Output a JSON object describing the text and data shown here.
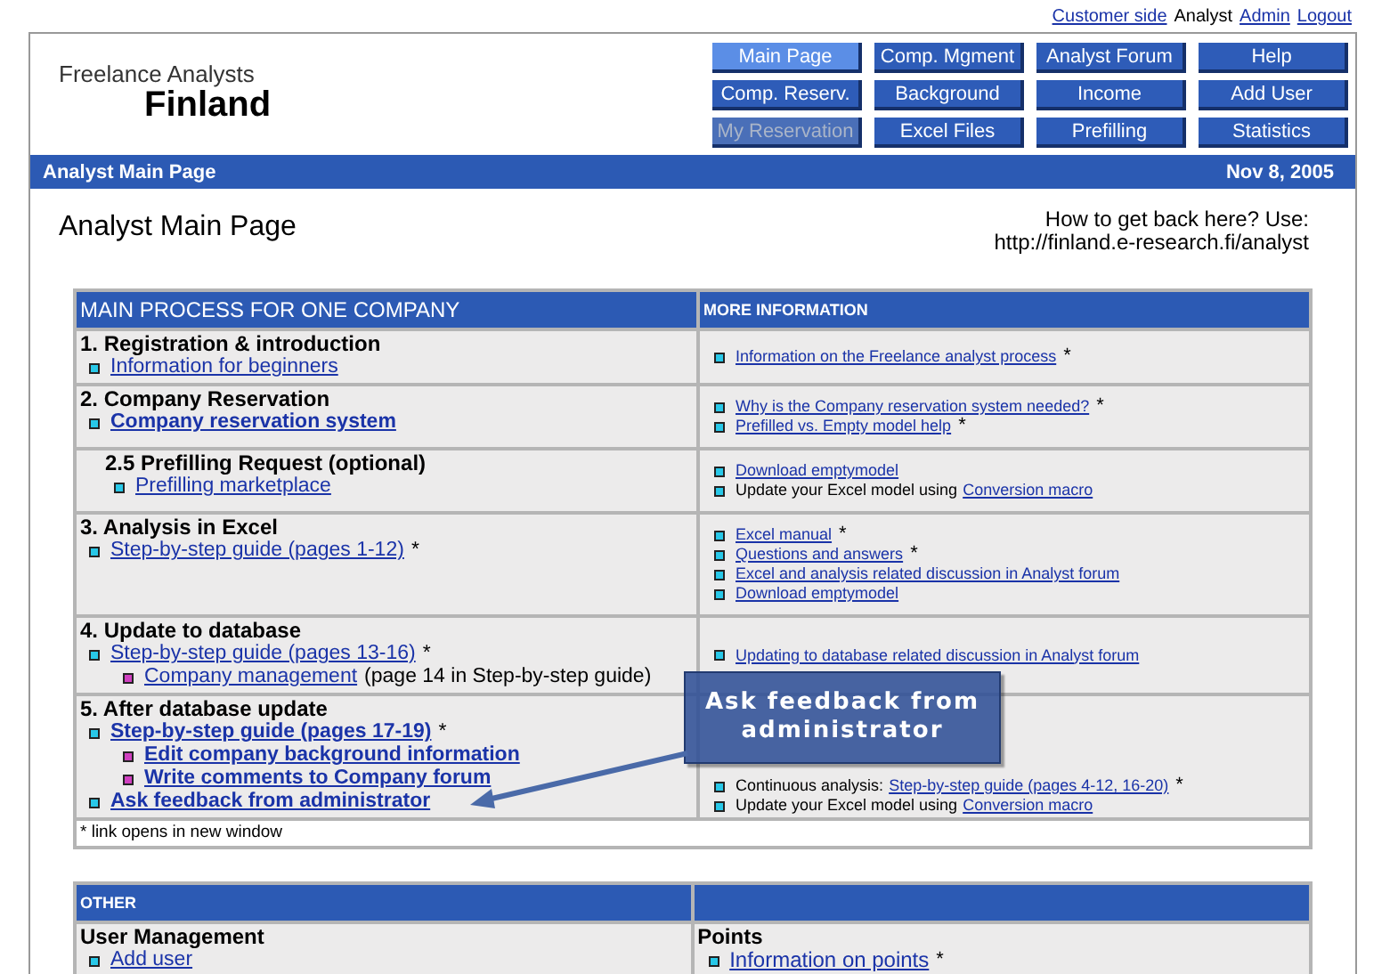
{
  "top_links": [
    {
      "label": "Customer side",
      "kind": "link"
    },
    {
      "label": "Analyst",
      "kind": "text"
    },
    {
      "label": "Admin",
      "kind": "link"
    },
    {
      "label": "Logout",
      "kind": "link"
    }
  ],
  "logo": {
    "line1": "Freelance Analysts",
    "line2": "Finland"
  },
  "nav_buttons": [
    {
      "label": "Main Page",
      "selected": true,
      "disabled": false
    },
    {
      "label": "Comp. Mgment",
      "selected": false,
      "disabled": false
    },
    {
      "label": "Analyst Forum",
      "selected": false,
      "disabled": false
    },
    {
      "label": "Help",
      "selected": false,
      "disabled": false
    },
    {
      "label": "Comp. Reserv.",
      "selected": false,
      "disabled": false
    },
    {
      "label": "Background",
      "selected": false,
      "disabled": false
    },
    {
      "label": "Income",
      "selected": false,
      "disabled": false
    },
    {
      "label": "Add User",
      "selected": false,
      "disabled": false
    },
    {
      "label": "My Reservation",
      "selected": false,
      "disabled": true
    },
    {
      "label": "Excel Files",
      "selected": false,
      "disabled": false
    },
    {
      "label": "Prefilling",
      "selected": false,
      "disabled": false
    },
    {
      "label": "Statistics",
      "selected": false,
      "disabled": false
    }
  ],
  "title_bar": {
    "title": "Analyst Main Page",
    "date": "Nov 8, 2005"
  },
  "page_title": "Analyst Main Page",
  "help": {
    "question": "How to get back here? Use:",
    "url": "http://finland.e-research.fi/analyst"
  },
  "main_table": {
    "headers": [
      "MAIN PROCESS FOR ONE COMPANY",
      "MORE INFORMATION"
    ],
    "rows": [
      {
        "heading": "1. Registration & introduction",
        "sub": false,
        "links": [
          {
            "text": "Information for beginners",
            "bold": false
          }
        ],
        "info": [
          {
            "link": "Information on the Freelance analyst process",
            "suffix": "*"
          }
        ]
      },
      {
        "heading": "2. Company Reservation",
        "sub": false,
        "links": [
          {
            "text": "Company reservation system",
            "bold": true
          }
        ],
        "info": [
          {
            "link": "Why is the Company reservation system needed?",
            "suffix": "*"
          },
          {
            "link": "Prefilled vs. Empty model help",
            "suffix": "*"
          }
        ]
      },
      {
        "heading": "2.5 Prefilling Request (optional)",
        "sub": true,
        "links": [
          {
            "text": "Prefilling marketplace",
            "bold": false
          }
        ],
        "info": [
          {
            "link": "Download emptymodel"
          },
          {
            "prefix": "Update your Excel model using",
            "link": "Conversion macro"
          }
        ]
      },
      {
        "heading": "3. Analysis in Excel",
        "sub": false,
        "links": [
          {
            "text": "Step-by-step guide (pages 1-12)",
            "suffix": "*",
            "bold": false
          }
        ],
        "info": [
          {
            "link": "Excel manual",
            "suffix": "*"
          },
          {
            "link": "Questions and answers",
            "suffix": "*"
          },
          {
            "link": "Excel and analysis related discussion in Analyst forum"
          },
          {
            "link": "Download emptymodel"
          }
        ]
      },
      {
        "heading": "4. Update to database",
        "sub": false,
        "links": [
          {
            "text": "Step-by-step guide (pages 13-16)",
            "suffix": "*",
            "bold": false,
            "children": [
              {
                "text": "Company management",
                "suffix": "(page 14 in Step-by-step guide)",
                "bold": false
              }
            ]
          }
        ],
        "info": [
          {
            "link": "Updating to database related discussion in Analyst forum"
          }
        ]
      },
      {
        "heading": "5. After database update",
        "sub": false,
        "links": [
          {
            "text": "Step-by-step guide (pages 17-19)",
            "suffix": "*",
            "bold": true,
            "children": [
              {
                "text": "Edit company background information",
                "bold": true
              },
              {
                "text": "Write comments to Company forum",
                "bold": true
              }
            ]
          },
          {
            "text": "Ask feedback from administrator",
            "bold": true
          }
        ],
        "info": [
          {
            "prefix": "Continuous analysis:",
            "link": "Step-by-step guide (pages 4-12, 16-20)",
            "suffix": "*"
          },
          {
            "prefix": "Update your Excel model using",
            "link": "Conversion macro"
          }
        ]
      }
    ],
    "footnote": "* link opens in new window"
  },
  "callout": {
    "text": "Ask feedback from administrator"
  },
  "other_table": {
    "header": "OTHER",
    "rows": [
      {
        "heading": "User Management",
        "sub": false,
        "links": [
          {
            "text": "Add user",
            "bold": false
          }
        ],
        "info_heading": "Points",
        "info": [
          {
            "link": "Information on points",
            "suffix": "*"
          }
        ]
      }
    ]
  }
}
